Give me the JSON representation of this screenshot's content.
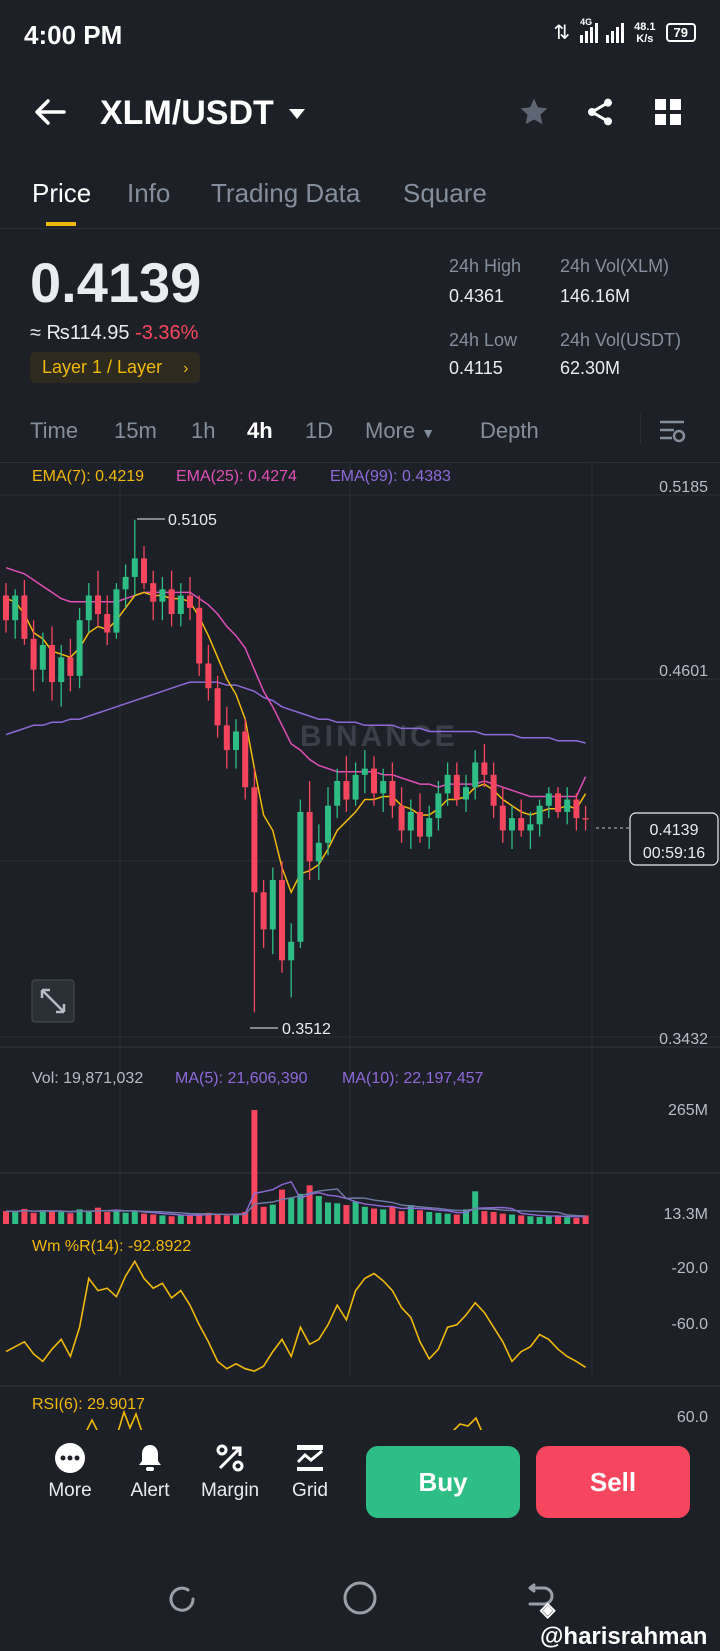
{
  "status_bar": {
    "time": "4:00 PM",
    "network": "4G",
    "speed": "48.1",
    "speed_unit": "K/s",
    "battery": "79"
  },
  "header": {
    "pair": "XLM/USDT"
  },
  "tabs": [
    {
      "label": "Price",
      "active": true
    },
    {
      "label": "Info"
    },
    {
      "label": "Trading Data"
    },
    {
      "label": "Square"
    }
  ],
  "ticker": {
    "price": "0.4139",
    "fiat_value": "≈ ₨114.95",
    "change": "-3.36%",
    "tag": "Layer 1 / Layer",
    "high_label": "24h High",
    "high": "0.4361",
    "low_label": "24h Low",
    "low": "0.4115",
    "vol_xlm_label": "24h Vol(XLM)",
    "vol_xlm": "146.16M",
    "vol_usdt_label": "24h Vol(USDT)",
    "vol_usdt": "62.30M"
  },
  "intervals": [
    "Time",
    "15m",
    "1h",
    "4h",
    "1D",
    "More",
    "Depth"
  ],
  "active_interval": "4h",
  "indicators": {
    "ema7": "EMA(7): 0.4219",
    "ema25": "EMA(25): 0.4274",
    "ema99": "EMA(99): 0.4383",
    "vol": "Vol: 19,871,032",
    "ma5": "MA(5): 21,606,390",
    "ma10": "MA(10): 22,197,457",
    "wr": "Wm %R(14): -92.8922",
    "rsi": "RSI(6): 29.9017"
  },
  "price_axis": [
    "0.5185",
    "0.4601",
    "0.3432"
  ],
  "volume_axis": [
    "265M",
    "13.3M"
  ],
  "wr_axis": [
    "-20.0",
    "-60.0"
  ],
  "rsi_axis": [
    "60.0"
  ],
  "markers": {
    "high": "0.5105",
    "low": "0.3512",
    "current": "0.4139",
    "countdown": "00:59:16"
  },
  "watermark_chart": "BINANCE",
  "bottom_actions": [
    {
      "label": "More",
      "icon": "more-icon"
    },
    {
      "label": "Alert",
      "icon": "bell-icon"
    },
    {
      "label": "Margin",
      "icon": "margin-icon"
    },
    {
      "label": "Grid",
      "icon": "grid-bot-icon"
    }
  ],
  "buy_label": "Buy",
  "sell_label": "Sell",
  "colors": {
    "up": "#2ebd85",
    "down": "#f6465d",
    "ema7": "#f0b90b",
    "ema25": "#e04fb8",
    "ema99": "#8e6ad8",
    "accent": "#f0b90b"
  },
  "chart_data": {
    "type": "candlestick",
    "interval": "4h",
    "ylim": [
      0.3432,
      0.5185
    ],
    "annotated_high": 0.5105,
    "annotated_low": 0.3512,
    "last_price": 0.4139,
    "candles": [
      [
        0.486,
        0.49,
        0.474,
        0.478
      ],
      [
        0.478,
        0.488,
        0.472,
        0.486
      ],
      [
        0.486,
        0.491,
        0.47,
        0.472
      ],
      [
        0.472,
        0.478,
        0.455,
        0.462
      ],
      [
        0.462,
        0.474,
        0.458,
        0.47
      ],
      [
        0.47,
        0.476,
        0.452,
        0.458
      ],
      [
        0.458,
        0.47,
        0.45,
        0.466
      ],
      [
        0.466,
        0.472,
        0.455,
        0.46
      ],
      [
        0.46,
        0.482,
        0.456,
        0.478
      ],
      [
        0.478,
        0.49,
        0.474,
        0.486
      ],
      [
        0.486,
        0.494,
        0.476,
        0.48
      ],
      [
        0.48,
        0.486,
        0.47,
        0.474
      ],
      [
        0.474,
        0.49,
        0.472,
        0.488
      ],
      [
        0.488,
        0.496,
        0.482,
        0.492
      ],
      [
        0.492,
        0.5105,
        0.486,
        0.498
      ],
      [
        0.498,
        0.502,
        0.488,
        0.49
      ],
      [
        0.49,
        0.494,
        0.478,
        0.484
      ],
      [
        0.484,
        0.492,
        0.478,
        0.488
      ],
      [
        0.488,
        0.494,
        0.476,
        0.48
      ],
      [
        0.48,
        0.49,
        0.476,
        0.486
      ],
      [
        0.486,
        0.492,
        0.478,
        0.482
      ],
      [
        0.482,
        0.486,
        0.46,
        0.464
      ],
      [
        0.464,
        0.47,
        0.452,
        0.456
      ],
      [
        0.456,
        0.46,
        0.44,
        0.444
      ],
      [
        0.444,
        0.45,
        0.43,
        0.436
      ],
      [
        0.436,
        0.446,
        0.43,
        0.442
      ],
      [
        0.442,
        0.446,
        0.42,
        0.424
      ],
      [
        0.424,
        0.43,
        0.3512,
        0.39
      ],
      [
        0.39,
        0.394,
        0.372,
        0.378
      ],
      [
        0.378,
        0.398,
        0.37,
        0.394
      ],
      [
        0.394,
        0.4,
        0.364,
        0.368
      ],
      [
        0.368,
        0.38,
        0.356,
        0.374
      ],
      [
        0.374,
        0.42,
        0.372,
        0.416
      ],
      [
        0.416,
        0.426,
        0.394,
        0.4
      ],
      [
        0.4,
        0.412,
        0.394,
        0.406
      ],
      [
        0.406,
        0.424,
        0.402,
        0.418
      ],
      [
        0.418,
        0.43,
        0.414,
        0.426
      ],
      [
        0.426,
        0.434,
        0.416,
        0.42
      ],
      [
        0.42,
        0.432,
        0.418,
        0.428
      ],
      [
        0.428,
        0.436,
        0.422,
        0.43
      ],
      [
        0.43,
        0.434,
        0.418,
        0.422
      ],
      [
        0.422,
        0.43,
        0.416,
        0.426
      ],
      [
        0.426,
        0.432,
        0.414,
        0.418
      ],
      [
        0.418,
        0.424,
        0.406,
        0.41
      ],
      [
        0.41,
        0.42,
        0.404,
        0.416
      ],
      [
        0.416,
        0.422,
        0.406,
        0.408
      ],
      [
        0.408,
        0.418,
        0.404,
        0.414
      ],
      [
        0.414,
        0.426,
        0.41,
        0.422
      ],
      [
        0.422,
        0.432,
        0.418,
        0.428
      ],
      [
        0.428,
        0.432,
        0.418,
        0.42
      ],
      [
        0.42,
        0.428,
        0.416,
        0.424
      ],
      [
        0.424,
        0.436,
        0.42,
        0.432
      ],
      [
        0.432,
        0.438,
        0.424,
        0.428
      ],
      [
        0.428,
        0.432,
        0.414,
        0.418
      ],
      [
        0.418,
        0.424,
        0.406,
        0.41
      ],
      [
        0.41,
        0.418,
        0.404,
        0.414
      ],
      [
        0.414,
        0.42,
        0.408,
        0.41
      ],
      [
        0.41,
        0.416,
        0.404,
        0.412
      ],
      [
        0.412,
        0.42,
        0.408,
        0.418
      ],
      [
        0.418,
        0.424,
        0.414,
        0.422
      ],
      [
        0.422,
        0.424,
        0.414,
        0.416
      ],
      [
        0.416,
        0.424,
        0.412,
        0.42
      ],
      [
        0.42,
        0.422,
        0.41,
        0.414
      ],
      [
        0.414,
        0.418,
        0.41,
        0.4139
      ]
    ],
    "ema7": [
      0.485,
      0.484,
      0.48,
      0.474,
      0.472,
      0.468,
      0.467,
      0.466,
      0.469,
      0.474,
      0.476,
      0.475,
      0.478,
      0.482,
      0.486,
      0.487,
      0.486,
      0.486,
      0.485,
      0.485,
      0.484,
      0.479,
      0.473,
      0.466,
      0.459,
      0.454,
      0.446,
      0.43,
      0.415,
      0.41,
      0.398,
      0.39,
      0.396,
      0.397,
      0.399,
      0.404,
      0.41,
      0.413,
      0.416,
      0.42,
      0.42,
      0.421,
      0.421,
      0.418,
      0.417,
      0.415,
      0.415,
      0.417,
      0.42,
      0.42,
      0.421,
      0.424,
      0.425,
      0.423,
      0.42,
      0.418,
      0.416,
      0.415,
      0.416,
      0.417,
      0.417,
      0.418,
      0.417,
      0.4219
    ],
    "ema25": [
      0.495,
      0.494,
      0.493,
      0.491,
      0.489,
      0.487,
      0.485,
      0.484,
      0.484,
      0.484,
      0.484,
      0.484,
      0.484,
      0.485,
      0.486,
      0.487,
      0.487,
      0.487,
      0.487,
      0.487,
      0.487,
      0.485,
      0.483,
      0.48,
      0.476,
      0.473,
      0.469,
      0.462,
      0.455,
      0.45,
      0.444,
      0.438,
      0.436,
      0.433,
      0.431,
      0.43,
      0.429,
      0.429,
      0.429,
      0.429,
      0.429,
      0.428,
      0.428,
      0.427,
      0.426,
      0.425,
      0.425,
      0.424,
      0.425,
      0.425,
      0.425,
      0.425,
      0.426,
      0.425,
      0.424,
      0.423,
      0.422,
      0.421,
      0.421,
      0.421,
      0.421,
      0.421,
      0.421,
      0.4274
    ],
    "ema99": [
      0.441,
      0.442,
      0.443,
      0.444,
      0.444,
      0.445,
      0.445,
      0.446,
      0.446,
      0.447,
      0.448,
      0.449,
      0.45,
      0.451,
      0.452,
      0.453,
      0.454,
      0.455,
      0.456,
      0.457,
      0.458,
      0.458,
      0.458,
      0.458,
      0.457,
      0.457,
      0.456,
      0.455,
      0.453,
      0.452,
      0.45,
      0.449,
      0.448,
      0.447,
      0.446,
      0.446,
      0.445,
      0.445,
      0.445,
      0.444,
      0.444,
      0.444,
      0.444,
      0.443,
      0.443,
      0.443,
      0.442,
      0.442,
      0.442,
      0.442,
      0.442,
      0.442,
      0.441,
      0.441,
      0.441,
      0.441,
      0.44,
      0.44,
      0.44,
      0.44,
      0.439,
      0.439,
      0.439,
      0.4383
    ],
    "volume_M": [
      30,
      28,
      35,
      26,
      32,
      30,
      28,
      25,
      34,
      30,
      38,
      28,
      32,
      26,
      30,
      24,
      22,
      20,
      18,
      22,
      20,
      24,
      26,
      22,
      20,
      22,
      28,
      265,
      40,
      45,
      80,
      60,
      70,
      90,
      65,
      50,
      48,
      44,
      52,
      40,
      36,
      34,
      40,
      30,
      44,
      32,
      28,
      26,
      24,
      22,
      34,
      76,
      30,
      28,
      24,
      22,
      20,
      18,
      16,
      18,
      20,
      16,
      14,
      19.9
    ],
    "wr": [
      -80,
      -76,
      -72,
      -82,
      -88,
      -78,
      -70,
      -84,
      -60,
      -20,
      -30,
      -28,
      -35,
      -18,
      -6,
      -20,
      -28,
      -24,
      -36,
      -30,
      -42,
      -58,
      -72,
      -88,
      -94,
      -90,
      -94,
      -96,
      -92,
      -80,
      -70,
      -84,
      -60,
      -74,
      -70,
      -58,
      -42,
      -54,
      -30,
      -20,
      -16,
      -22,
      -30,
      -44,
      -52,
      -72,
      -86,
      -78,
      -60,
      -58,
      -50,
      -40,
      -48,
      -60,
      -72,
      -88,
      -80,
      -76,
      -66,
      -70,
      -78,
      -84,
      -88,
      -92.9
    ],
    "rsi_visible": [
      30,
      62,
      30
    ]
  }
}
